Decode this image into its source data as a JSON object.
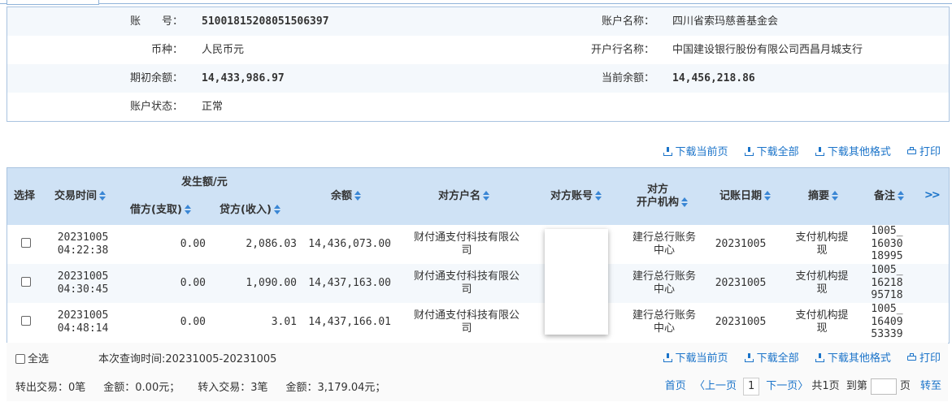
{
  "account": {
    "no_label": "账　　号：",
    "no_value": "51001815208051506397",
    "name_label": "账户名称：",
    "name_value": "四川省索玛慈善基金会",
    "currency_label": "币种：",
    "currency_value": "人民币元",
    "bank_label": "开户行名称：",
    "bank_value": "中国建设银行股份有限公司西昌月城支行",
    "opening_label": "期初余额：",
    "opening_value": "14,433,986.97",
    "current_label": "当前余额：",
    "current_value": "14,456,218.86",
    "status_label": "账户状态：",
    "status_value": "正常"
  },
  "actions": {
    "download_page": "下载当前页",
    "download_all": "下载全部",
    "download_other": "下载其他格式",
    "print": "打印"
  },
  "table": {
    "headers": {
      "select": "选择",
      "time": "交易时间",
      "amount_group": "发生额/元",
      "debit": "借方(支取)",
      "credit": "贷方(收入)",
      "balance": "余额",
      "counterparty_name": "对方户名",
      "counterparty_account": "对方账号",
      "counterparty_bank_1": "对方",
      "counterparty_bank_2": "开户机构",
      "post_date": "记账日期",
      "summary": "摘要",
      "note": "备注",
      "more": ">>"
    },
    "rows": [
      {
        "date": "20231005",
        "clock": "04:22:38",
        "debit": "0.00",
        "credit": "2,086.03",
        "balance": "14,436,073.00",
        "name_1": "财付通支付科技有限公",
        "name_2": "司",
        "bank_1": "建行总行账务",
        "bank_2": "中心",
        "post_date": "20231005",
        "summary_1": "支付机构提",
        "summary_2": "现",
        "note_1": "1005_",
        "note_2": "16030",
        "note_3": "18995"
      },
      {
        "date": "20231005",
        "clock": "04:30:45",
        "debit": "0.00",
        "credit": "1,090.00",
        "balance": "14,437,163.00",
        "name_1": "财付通支付科技有限公",
        "name_2": "司",
        "bank_1": "建行总行账务",
        "bank_2": "中心",
        "post_date": "20231005",
        "summary_1": "支付机构提",
        "summary_2": "现",
        "note_1": "1005_",
        "note_2": "16218",
        "note_3": "95718"
      },
      {
        "date": "20231005",
        "clock": "04:48:14",
        "debit": "0.00",
        "credit": "3.01",
        "balance": "14,437,166.01",
        "name_1": "财付通支付科技有限公",
        "name_2": "司",
        "bank_1": "建行总行账务",
        "bank_2": "中心",
        "post_date": "20231005",
        "summary_1": "支付机构提",
        "summary_2": "现",
        "note_1": "1005_",
        "note_2": "16409",
        "note_3": "53339"
      }
    ]
  },
  "footer": {
    "select_all": "全选",
    "query_time": "本次查询时间:20231005-20231005",
    "out_tx": "转出交易：0笔",
    "out_amount": "金额：0.00元；",
    "in_tx": "转入交易：3笔",
    "in_amount": "金额：3,179.04元；"
  },
  "pager": {
    "first": "首页",
    "prev": "〈上一页",
    "current": "1",
    "next": "下一页〉",
    "total": "共1页",
    "goto": "到第",
    "page_unit": "页",
    "jump": "转至"
  }
}
